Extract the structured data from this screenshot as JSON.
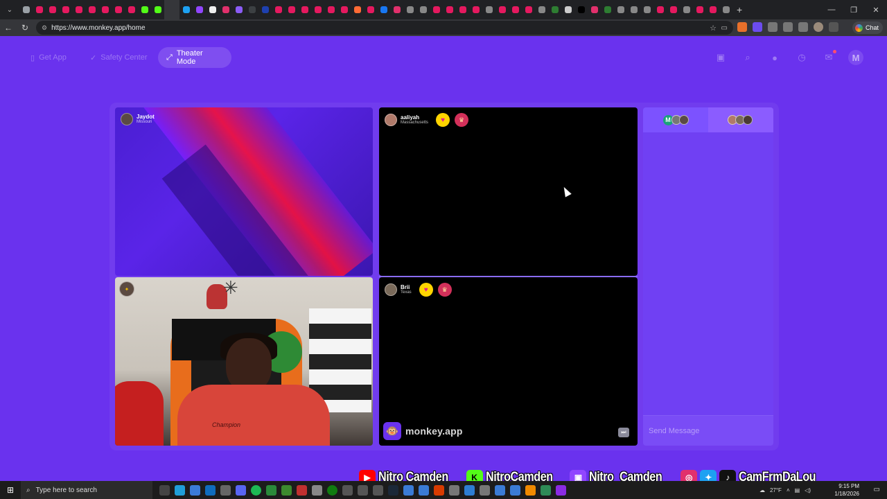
{
  "browser": {
    "url": "https://www.monkey.app/home",
    "chat_label": "Chat",
    "tab_colors": [
      "#9aa0a6",
      "#e5195f",
      "#e5195f",
      "#e5195f",
      "#e5195f",
      "#e5195f",
      "#e5195f",
      "#e5195f",
      "#e5195f",
      "#53fc18",
      "#53fc18",
      "#35363a",
      "#1da1f2",
      "#9146ff",
      "#eeeeee",
      "#e1306c",
      "#8b5cf6",
      "#3c4043",
      "#1e40af",
      "#e5195f",
      "#e5195f",
      "#e5195f",
      "#e5195f",
      "#e5195f",
      "#e5195f",
      "#ff6b35",
      "#e5195f",
      "#1877f2",
      "#e1306c",
      "#888888",
      "#888888",
      "#e5195f",
      "#e5195f",
      "#e5195f",
      "#e5195f",
      "#888888",
      "#e5195f",
      "#e5195f",
      "#e5195f",
      "#888888",
      "#2e7d32",
      "#cccccc",
      "#000000",
      "#e1306c",
      "#2e7d32",
      "#888888",
      "#888888",
      "#888888",
      "#e5195f",
      "#e5195f",
      "#888888",
      "#e5195f",
      "#e5195f",
      "#888888"
    ]
  },
  "nav": {
    "get_app": "Get App",
    "safety_center": "Safety Center",
    "theater_mode": "Theater Mode",
    "avatar_initial": "M"
  },
  "tiles": {
    "t1": {
      "name": "Jaydot",
      "location": "Missouri"
    },
    "t2": {
      "name": "aaliyah",
      "location": "Massachusetts"
    },
    "t4": {
      "name": "Brii",
      "location": "Texas"
    },
    "shirt_text": "Champion",
    "brand": "monkey.app"
  },
  "chat": {
    "tab_initial": "M",
    "placeholder": "Send Message"
  },
  "overlay": {
    "youtube": "Nitro Camden",
    "kick": "NitroCamden",
    "twitch": "Nitro_Camden",
    "socials": "CamFrmDaLou"
  },
  "taskbar": {
    "search_placeholder": "Type here to search",
    "weather": "27°F",
    "time": "9:15 PM",
    "date": "1/18/2026"
  },
  "colors": {
    "page_bg": "#6a32ee",
    "chat_bg": "#7040f3",
    "heart_badge": "#ffd400",
    "youtube": "#ff0000",
    "kick": "#53fc18",
    "twitch": "#9146ff"
  }
}
